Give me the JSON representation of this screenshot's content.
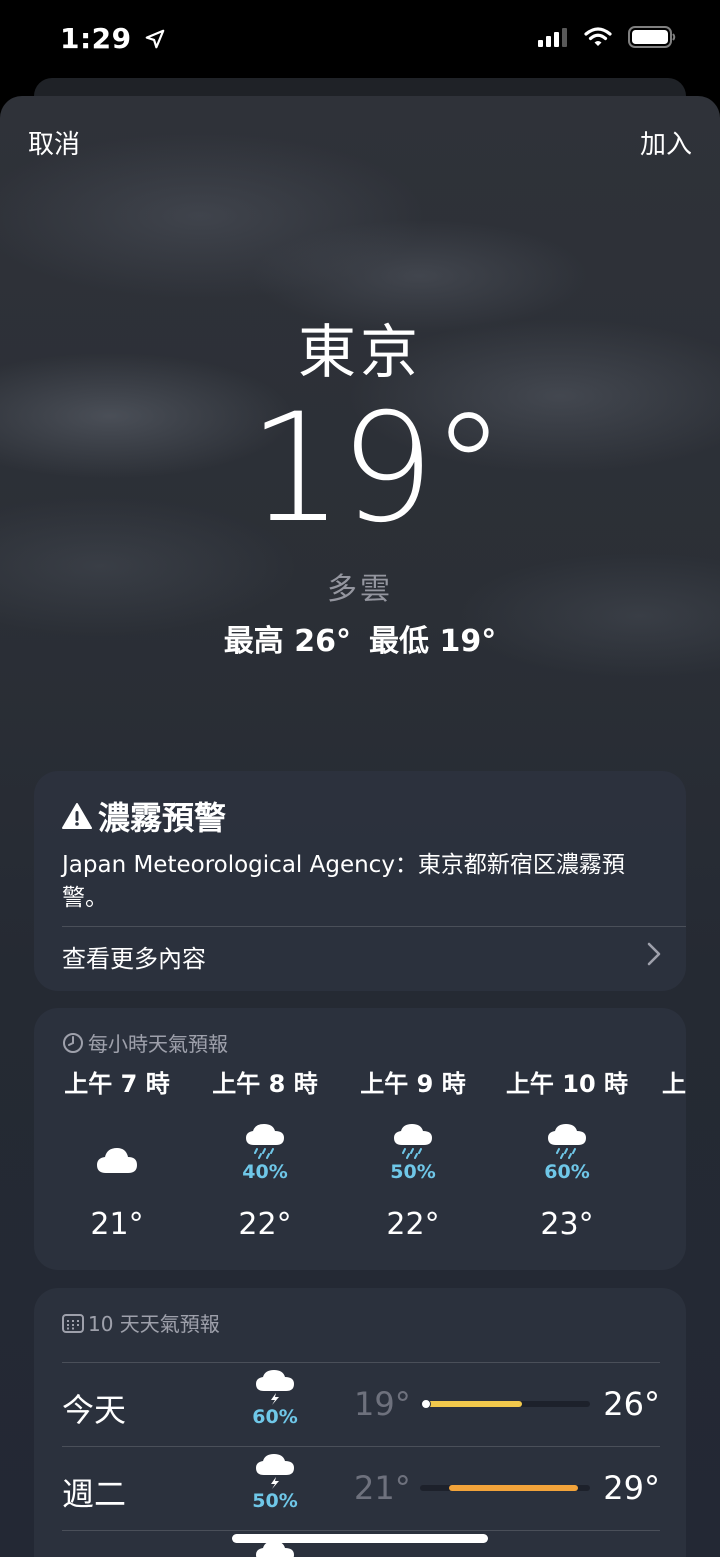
{
  "status_bar": {
    "time": "1:29",
    "location_icon": "location-arrow-icon",
    "signal_icon": "signal-icon",
    "wifi_icon": "wifi-icon",
    "battery_icon": "battery-icon"
  },
  "nav": {
    "cancel_label": "取消",
    "add_label": "加入"
  },
  "current": {
    "city": "東京",
    "temperature": "19°",
    "condition": "多雲",
    "high": "最高 26°",
    "low": "最低 19°"
  },
  "alert": {
    "title": "濃霧預警",
    "body": "Japan Meteorological Agency：東京都新宿区濃霧預警。",
    "more_label": "查看更多內容",
    "icon": "warning-icon"
  },
  "hourly": {
    "header": "每小時天氣預報",
    "icon": "clock-icon",
    "items": [
      {
        "time": "上午 7 時",
        "icon": "cloud-icon",
        "precip": "",
        "temp": "21°"
      },
      {
        "time": "上午 8 時",
        "icon": "cloud-drizzle-icon",
        "precip": "40%",
        "temp": "22°"
      },
      {
        "time": "上午 9 時",
        "icon": "cloud-drizzle-icon",
        "precip": "50%",
        "temp": "22°"
      },
      {
        "time": "上午 10 時",
        "icon": "cloud-drizzle-icon",
        "precip": "60%",
        "temp": "23°"
      },
      {
        "time": "上",
        "icon": "",
        "precip": "",
        "temp": ""
      }
    ]
  },
  "daily": {
    "header": "10 天天氣預報",
    "icon": "calendar-icon",
    "days": [
      {
        "name": "今天",
        "icon": "cloud-bolt-icon",
        "precip": "60%",
        "low": "19°",
        "high": "26°",
        "range_start": 0.02,
        "range_end": 0.6,
        "bar_color": "#f2c94c",
        "current_dot": true
      },
      {
        "name": "週二",
        "icon": "cloud-bolt-icon",
        "precip": "50%",
        "low": "21°",
        "high": "29°",
        "range_start": 0.17,
        "range_end": 0.93,
        "bar_color": "#f2a33a",
        "current_dot": false
      }
    ]
  }
}
